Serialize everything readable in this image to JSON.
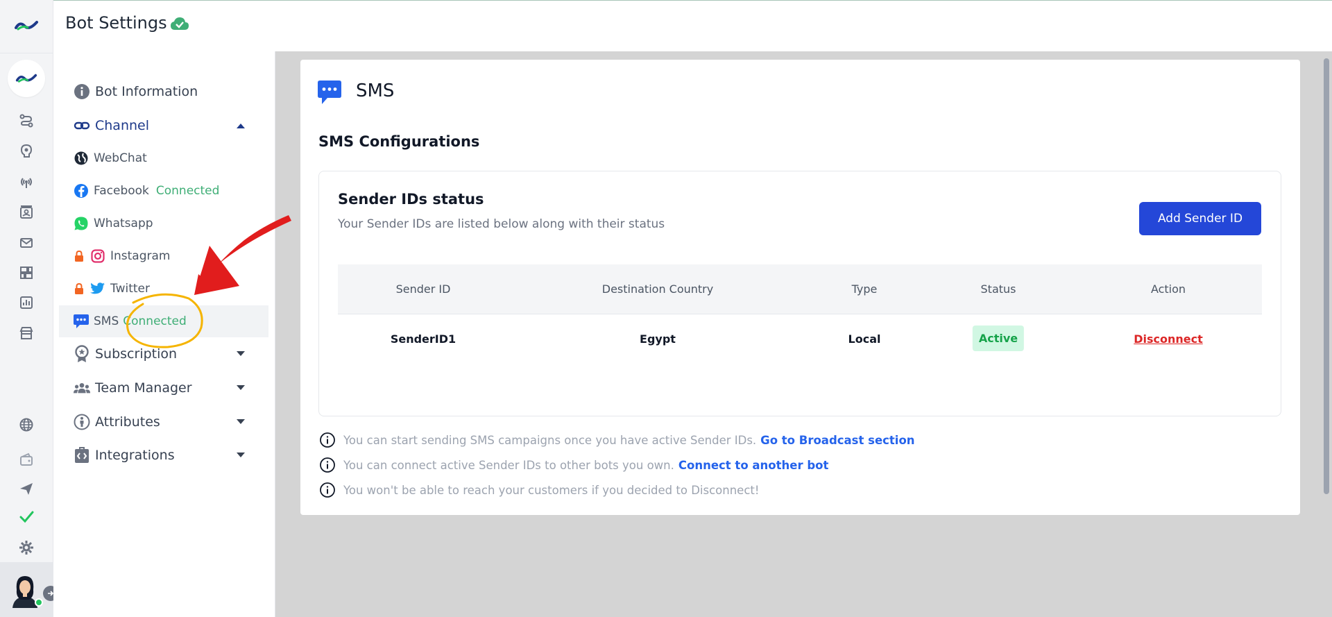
{
  "header": {
    "title": "Bot Settings"
  },
  "settings_nav": {
    "items": [
      {
        "label": "Bot Information",
        "icon": "info-icon"
      },
      {
        "label": "Channel",
        "icon": "link-icon"
      },
      {
        "label": "Subscription",
        "icon": "award-icon"
      },
      {
        "label": "Team Manager",
        "icon": "team-icon"
      },
      {
        "label": "Attributes",
        "icon": "person-icon"
      },
      {
        "label": "Integrations",
        "icon": "code-icon"
      }
    ],
    "channels": [
      {
        "label": "WebChat",
        "icon": "globe-icon",
        "status": ""
      },
      {
        "label": "Facebook",
        "icon": "facebook-icon",
        "status": "Connected"
      },
      {
        "label": "Whatsapp",
        "icon": "whatsapp-icon",
        "status": ""
      },
      {
        "label": "Instagram",
        "icon": "instagram-icon",
        "status": "",
        "locked": true
      },
      {
        "label": "Twitter",
        "icon": "twitter-icon",
        "status": "",
        "locked": true
      },
      {
        "label": "SMS",
        "icon": "sms-icon",
        "status": "Connected",
        "selected": true
      }
    ]
  },
  "main": {
    "title": "SMS",
    "config_title": "SMS Configurations",
    "sender_ids": {
      "title": "Sender IDs status",
      "subtitle": "Your Sender IDs are listed below along with their status",
      "add_button": "Add Sender ID",
      "columns": [
        "Sender ID",
        "Destination Country",
        "Type",
        "Status",
        "Action"
      ],
      "rows": [
        {
          "sender_id": "SenderID1",
          "country": "Egypt",
          "type": "Local",
          "status": "Active",
          "action": "Disconnect"
        }
      ]
    },
    "notes": [
      {
        "text": "You can start sending SMS campaigns once you have active Sender IDs.",
        "link": "Go to Broadcast section"
      },
      {
        "text": "You can connect active Sender IDs to other bots you own.",
        "link": "Connect to another bot"
      },
      {
        "text": "You won't be able to reach your customers if you decided to Disconnect!",
        "link": ""
      }
    ]
  },
  "colors": {
    "accent": "#2447d8",
    "connected": "#3fae76",
    "active_badge_bg": "#d1f7e3",
    "danger": "#dc2626",
    "annotation_arrow": "#e11d1d",
    "annotation_circle": "#f5b400"
  }
}
